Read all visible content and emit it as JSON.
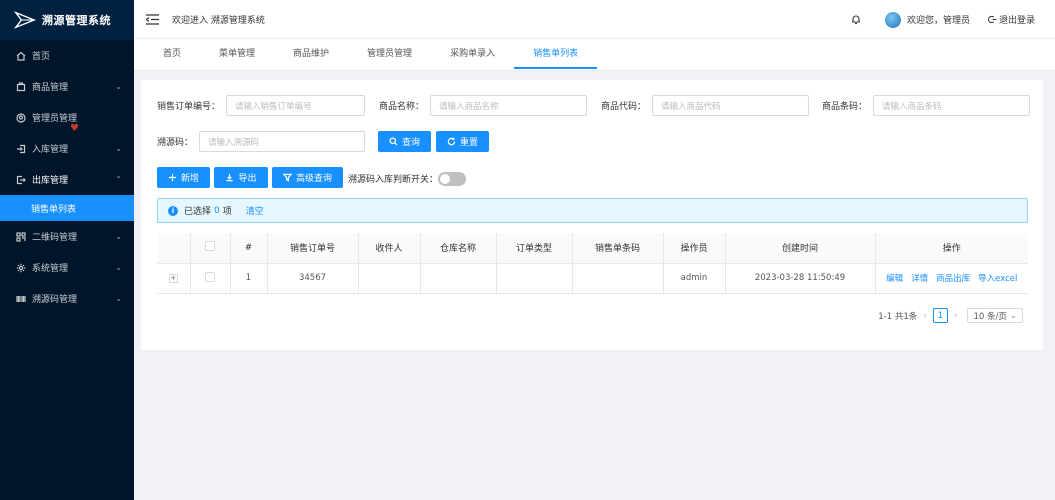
{
  "app": {
    "title": "溯源管理系统"
  },
  "sidebar": {
    "items": [
      {
        "label": "首页",
        "icon": "home-icon",
        "arrow": ""
      },
      {
        "label": "商品管理",
        "icon": "box-icon",
        "arrow": "⌄"
      },
      {
        "label": "管理员管理",
        "icon": "user-circle-icon",
        "arrow": ""
      },
      {
        "label": "入库管理",
        "icon": "login-icon",
        "arrow": "⌄"
      },
      {
        "label": "出库管理",
        "icon": "logout-icon",
        "arrow": "⌃"
      }
    ],
    "sub_active": "销售单列表",
    "items_after": [
      {
        "label": "二维码管理",
        "icon": "qrcode-icon",
        "arrow": "⌄"
      },
      {
        "label": "系统管理",
        "icon": "gear-icon",
        "arrow": "⌄"
      },
      {
        "label": "溯源码管理",
        "icon": "barcode-icon",
        "arrow": "⌄"
      }
    ]
  },
  "header": {
    "welcome": "欢迎进入 溯源管理系统",
    "user_greet": "欢迎您，管理员",
    "logout": "退出登录"
  },
  "tabs": [
    "首页",
    "菜单管理",
    "商品维护",
    "管理员管理",
    "采购单录入",
    "销售单列表"
  ],
  "active_tab": "销售单列表",
  "search": {
    "order_no_label": "销售订单编号：",
    "order_no_placeholder": "请输入销售订单编号",
    "name_label": "商品名称：",
    "name_placeholder": "请输入商品名称",
    "code_label": "商品代码：",
    "code_placeholder": "请输入商品代码",
    "barcode_label": "商品条码：",
    "barcode_placeholder": "请输入商品条码",
    "trace_label": "溯源码：",
    "trace_placeholder": "请输入溯源码",
    "query_btn": "查询",
    "reset_btn": "重置"
  },
  "toolbar": {
    "add": "新增",
    "export": "导出",
    "advanced": "高级查询",
    "switch_label": "溯源码入库判断开关："
  },
  "alert": {
    "prefix": "已选择",
    "count": "0",
    "suffix": "项",
    "clear": "清空"
  },
  "table": {
    "columns": [
      "#",
      "销售订单号",
      "收件人",
      "仓库名称",
      "订单类型",
      "销售单条码",
      "操作员",
      "创建时间",
      "操作"
    ],
    "rows": [
      {
        "index": "1",
        "order_no": "34567",
        "receiver": "",
        "warehouse": "",
        "order_type": "",
        "barcode": "",
        "operator": "admin",
        "created": "2023-03-28 11:50:49"
      }
    ],
    "actions": [
      "编辑",
      "详情",
      "商品出库",
      "导入excel"
    ]
  },
  "pager": {
    "total": "1-1 共1条",
    "page": "1",
    "size": "10 条/页"
  },
  "colors": {
    "primary": "#1890ff",
    "sidebar_bg": "#001529"
  }
}
